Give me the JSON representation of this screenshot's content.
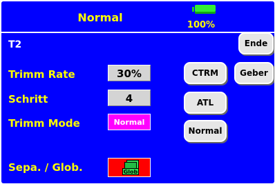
{
  "header": {
    "title": "Normal",
    "battery_percent": "100%",
    "battery_level": 1.0
  },
  "model": {
    "name": "T2"
  },
  "rows": {
    "trimm_rate": {
      "label": "Trimm Rate",
      "value": "30%"
    },
    "schritt": {
      "label": "Schritt",
      "value": "4"
    },
    "trimm_mode": {
      "label": "Trimm Mode",
      "value": "Normal"
    },
    "sepa_glob": {
      "label": "Sepa. / Glob.",
      "icon_text": "Glob"
    }
  },
  "buttons": {
    "ende": "Ende",
    "geber": "Geber",
    "ctrm": "CTRM",
    "atl": "ATL",
    "normal": "Normal"
  },
  "colors": {
    "background": "#0000ff",
    "label_yellow": "#ffff00",
    "mode_magenta": "#ff00ff",
    "glob_red": "#ff0000",
    "battery_green": "#33ee33"
  },
  "icons": {
    "battery": "battery-icon",
    "glob": "glob-pages-icon"
  }
}
